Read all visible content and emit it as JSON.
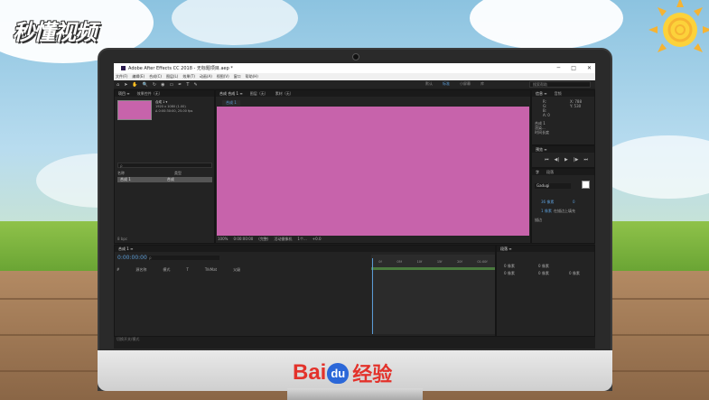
{
  "watermark": {
    "text": "秒懂视频"
  },
  "baidu_logo": {
    "bai": "Bai",
    "du": "du",
    "jingyan": "经验"
  },
  "window": {
    "title": "Adobe After Effects CC 2018 - 无标题项目.aep *",
    "buttons": [
      "─",
      "□",
      "✕"
    ]
  },
  "menu": [
    "文件(F)",
    "编辑(E)",
    "合成(C)",
    "图层(L)",
    "效果(T)",
    "动画(A)",
    "视图(V)",
    "窗口",
    "帮助(H)"
  ],
  "workspaces": {
    "items": [
      "默认",
      "标准",
      "小屏幕",
      "库"
    ],
    "active": "标准"
  },
  "search_placeholder": "搜索帮助",
  "project_panel": {
    "tabs": [
      "项目 ≡",
      "效果控件（无）"
    ],
    "comp_name": "合成 1 ▾",
    "info_lines": [
      "1920 x 1080 (1.00)",
      "Δ 0:00:30:00, 25.00 fps"
    ],
    "search_placeholder": "ρ",
    "columns": [
      "名称",
      "类型"
    ],
    "row": {
      "name": "合成 1",
      "type": "合成"
    },
    "bpc": "8 bpc"
  },
  "composition_panel": {
    "tabs": [
      "合成 合成 1 ≡",
      "图层（无）",
      "素材（无）"
    ],
    "active_tab": "合成 1",
    "bg_color": "#c763ab",
    "bottom_controls": [
      "100%",
      "0:00:00:00",
      "(完整)",
      "活动摄像机",
      "1个...",
      "+0.0"
    ]
  },
  "right_panels": {
    "info": {
      "tabs": [
        "信息 ≡",
        "音频"
      ],
      "lines": [
        "R:",
        "G:",
        "B:",
        "A: 0",
        "X: 788",
        "Y: 530",
        "合成 1",
        "渲染...",
        "时间长度"
      ]
    },
    "preview": {
      "title": "预览 ≡",
      "controls": [
        "⏮",
        "◀|",
        "▶",
        "|▶",
        "⏭"
      ]
    },
    "character": {
      "tabs": [
        "字",
        "段落"
      ],
      "font": "Gadugi",
      "fill_label": "描边",
      "size": "36 像素",
      "tracking": "0",
      "stroke": "1 像素",
      "mode": "在描边上填充"
    },
    "paragraph": {
      "title": "段落 ≡",
      "indents": [
        "0 像素",
        "0 像素",
        "0 像素",
        "0 像素",
        "0 像素"
      ]
    }
  },
  "timeline": {
    "tab": "合成 1 ≡",
    "timecode": "0:00:00:00",
    "search_placeholder": "ρ",
    "columns": [
      "#",
      "源名称",
      "模式",
      "T",
      "TrkMat",
      "父级"
    ],
    "ruler": [
      "0f",
      "05f",
      "10f",
      "15f",
      "20f",
      "01:00f"
    ]
  },
  "status": {
    "left": "切换开关/模式"
  }
}
